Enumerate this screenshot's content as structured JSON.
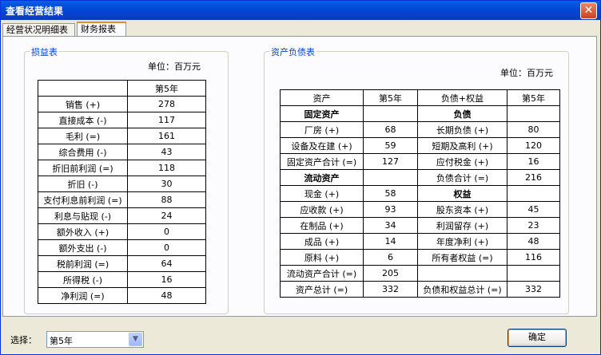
{
  "window": {
    "title": "查看经营结果",
    "close": "✕"
  },
  "tabs": [
    "经营状况明细表",
    "财务报表"
  ],
  "income": {
    "group_title": "损益表",
    "unit": "单位：百万元",
    "header": [
      "",
      "第5年"
    ],
    "rows": [
      [
        "销售 (+)",
        "278"
      ],
      [
        "直接成本 (-)",
        "117"
      ],
      [
        "毛利 (=)",
        "161"
      ],
      [
        "综合费用 (-)",
        "43"
      ],
      [
        "折旧前利润 (=)",
        "118"
      ],
      [
        "折旧 (-)",
        "30"
      ],
      [
        "支付利息前利润 (=)",
        "88"
      ],
      [
        "利息与贴现 (-)",
        "24"
      ],
      [
        "额外收入 (+)",
        "0"
      ],
      [
        "额外支出 (-)",
        "0"
      ],
      [
        "税前利润 (=)",
        "64"
      ],
      [
        "所得税 (-)",
        "16"
      ],
      [
        "净利润 (=)",
        "48"
      ]
    ]
  },
  "balance": {
    "group_title": "资产负债表",
    "unit": "单位：百万元",
    "header": [
      "资产",
      "第5年",
      "负债+权益",
      "第5年"
    ],
    "rows": [
      [
        "固定资产",
        "",
        "负债",
        ""
      ],
      [
        "厂房 (+)",
        "68",
        "长期负债 (+)",
        "80"
      ],
      [
        "设备及在建 (+)",
        "59",
        "短期及高利 (+)",
        "120"
      ],
      [
        "固定资产合计 (=)",
        "127",
        "应付税金 (+)",
        "16"
      ],
      [
        "流动资产",
        "",
        "负债合计 (=)",
        "216"
      ],
      [
        "现金 (+)",
        "58",
        "权益",
        ""
      ],
      [
        "应收款 (+)",
        "93",
        "股东资本 (+)",
        "45"
      ],
      [
        "在制品 (+)",
        "34",
        "利润留存 (+)",
        "23"
      ],
      [
        "成品 (+)",
        "14",
        "年度净利 (+)",
        "48"
      ],
      [
        "原料 (+)",
        "6",
        "所有者权益 (=)",
        "116"
      ],
      [
        "流动资产合计 (=)",
        "205",
        "",
        ""
      ],
      [
        "资产总计 (=)",
        "332",
        "负债和权益总计 (=)",
        "332"
      ]
    ]
  },
  "footer": {
    "select_label": "选择：",
    "select_value": "第5年",
    "ok": "确定"
  }
}
